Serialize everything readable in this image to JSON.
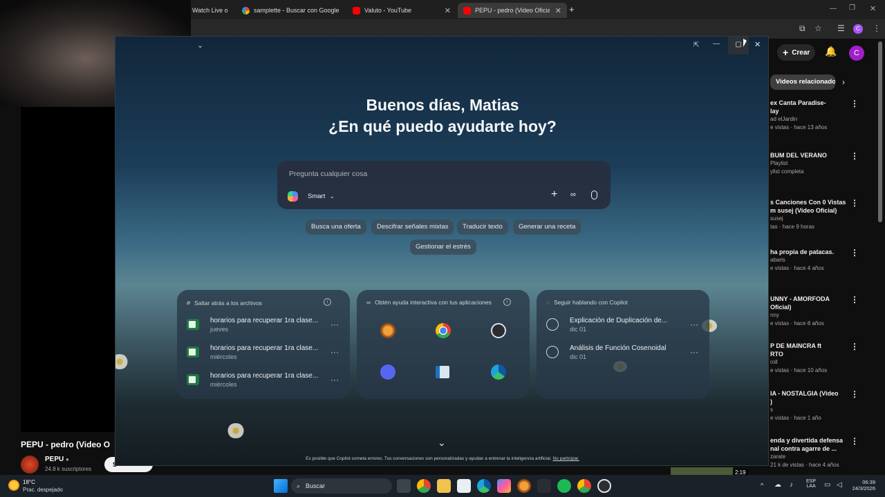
{
  "browser": {
    "tabs": [
      {
        "label": "Watch Live o"
      },
      {
        "label": "samplette - Buscar con Google"
      },
      {
        "label": "Valuto - YouTube"
      },
      {
        "label": "PEPU - pedro (Video Oficial) - Y"
      }
    ],
    "new_tab": "+",
    "profile_initial": "C"
  },
  "youtube": {
    "create_label": "Crear",
    "profile_initial": "C",
    "related_label": "Videos relacionado",
    "video_title": "PEPU - pedro (Video O",
    "channel_name": "PEPU",
    "subscribers": "24.8 k suscriptores",
    "subscribe_fragment": "S",
    "duration": "2:19",
    "related": [
      {
        "title": "ex Canta Paradise-",
        "title2": "lay",
        "meta1": "ad elJardin",
        "meta2": "e vistas · hace 13 años"
      },
      {
        "title": "BUM DEL VERANO",
        "title2": "",
        "meta1": "Playlist",
        "meta2": "ylist completa"
      },
      {
        "title": "s Canciones Con 0 Vistas",
        "title2": "m susej (Video Oficial)",
        "meta1": "susej",
        "meta2": "tas · hace 9 horas"
      },
      {
        "title": "ha propia de patacas.",
        "title2": "",
        "meta1": "abaris",
        "meta2": "e vistas · hace 4 años"
      },
      {
        "title": "UNNY - AMORFODA",
        "title2": "Oficial)",
        "meta1": "nny",
        "meta2": "e vistas · hace 8 años"
      },
      {
        "title": "P DE MAINCRA ft",
        "title2": "RTO",
        "meta1": "roll",
        "meta2": "e vistas · hace 10 años"
      },
      {
        "title": "IA - NOSTALGIA (Video",
        "title2": ")",
        "meta1": "s",
        "meta2": "e vistas · hace 1 año"
      },
      {
        "title": "enda y divertida defensa",
        "title2": "nal contra agarre de ...",
        "meta1": "zarate",
        "meta2": "21 k de vistas · hace 4 años"
      }
    ]
  },
  "copilot": {
    "greeting": "Buenos días, Matias",
    "question": "¿En qué puedo ayudarte hoy?",
    "input_placeholder": "Pregunta cualquier cosa",
    "mode": "Smart",
    "chips": [
      "Busca una oferta",
      "Descifrar señales mixtas",
      "Traducir texto",
      "Generar una receta",
      "Gestionar el estrés"
    ],
    "files_card": {
      "header": "Saltar atrás a los archivos",
      "items": [
        {
          "title": "horarios para recuperar 1ra clase...",
          "sub": "jueves"
        },
        {
          "title": "horarios para recuperar 1ra clase...",
          "sub": "miércoles"
        },
        {
          "title": "horarios para recuperar 1ra clase...",
          "sub": "miércoles"
        }
      ]
    },
    "apps_card": {
      "header": "Obtén ayuda interactiva con tus aplicaciones",
      "apps": [
        "fl-studio-icon",
        "chrome-icon",
        "obs-icon",
        "discord-icon",
        "window-app-icon",
        "edge-icon"
      ]
    },
    "chats_card": {
      "header": "Seguir hablando con Copilot",
      "items": [
        {
          "title": "Explicación de Duplicación de...",
          "sub": "dic 01"
        },
        {
          "title": "Análisis de Función Cosenoidal",
          "sub": "dic 01"
        }
      ]
    },
    "disclaimer": "Es posible que Copilot cometa errores. Tus conversaciones son personalizadas y ayudan a entrenar la inteligencia artificial.",
    "disclaimer_link": "No participar."
  },
  "taskbar": {
    "weather_temp": "18°C",
    "weather_desc": "Prac. despejado",
    "search_label": "Buscar",
    "lang1": "ESP",
    "lang2": "LAA",
    "time": "06:39",
    "date": "24/3/2026"
  },
  "colors": {
    "accent": "#a855f7",
    "excel": "#1f7a44",
    "taskbar": "#1b2128"
  }
}
